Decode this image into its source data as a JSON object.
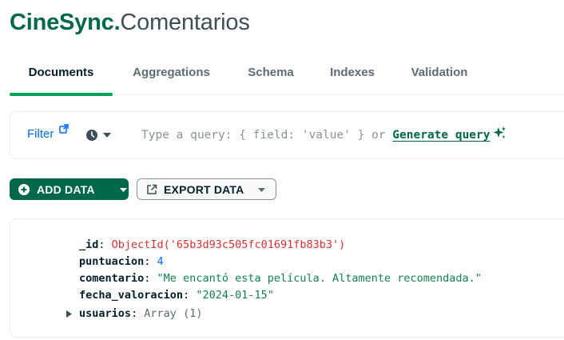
{
  "header": {
    "database": "CineSync",
    "separator": ".",
    "collection": "Comentarios"
  },
  "tabs": [
    {
      "label": "Documents",
      "active": true
    },
    {
      "label": "Aggregations",
      "active": false
    },
    {
      "label": "Schema",
      "active": false
    },
    {
      "label": "Indexes",
      "active": false
    },
    {
      "label": "Validation",
      "active": false
    }
  ],
  "query_bar": {
    "filter_label": "Filter",
    "placeholder": "Type a query: { field: 'value' } or",
    "generate_link": "Generate query",
    "icons": [
      "external-link-icon",
      "clock-icon",
      "caret-down-icon",
      "sparkle-icon"
    ]
  },
  "actions": {
    "add_data": "ADD DATA",
    "export_data": "EXPORT DATA"
  },
  "document": {
    "fields": [
      {
        "key": "_id",
        "value": "ObjectId('65b3d93c505fc01691fb83b3')",
        "type": "objectid"
      },
      {
        "key": "puntuacion",
        "value": "4",
        "type": "number"
      },
      {
        "key": "comentario",
        "value": "\"Me encantó esta película. Altamente recomendada.\"",
        "type": "string"
      },
      {
        "key": "fecha_valoracion",
        "value": "\"2024-01-15\"",
        "type": "string"
      },
      {
        "key": "usuarios",
        "value": "Array (1)",
        "type": "array",
        "expandable": true
      }
    ]
  },
  "colors": {
    "brand_green": "#00684a",
    "tab_underline": "#00a35c",
    "link_blue": "#016bf8",
    "objectid_red": "#db3030",
    "string_green": "#12824d"
  }
}
